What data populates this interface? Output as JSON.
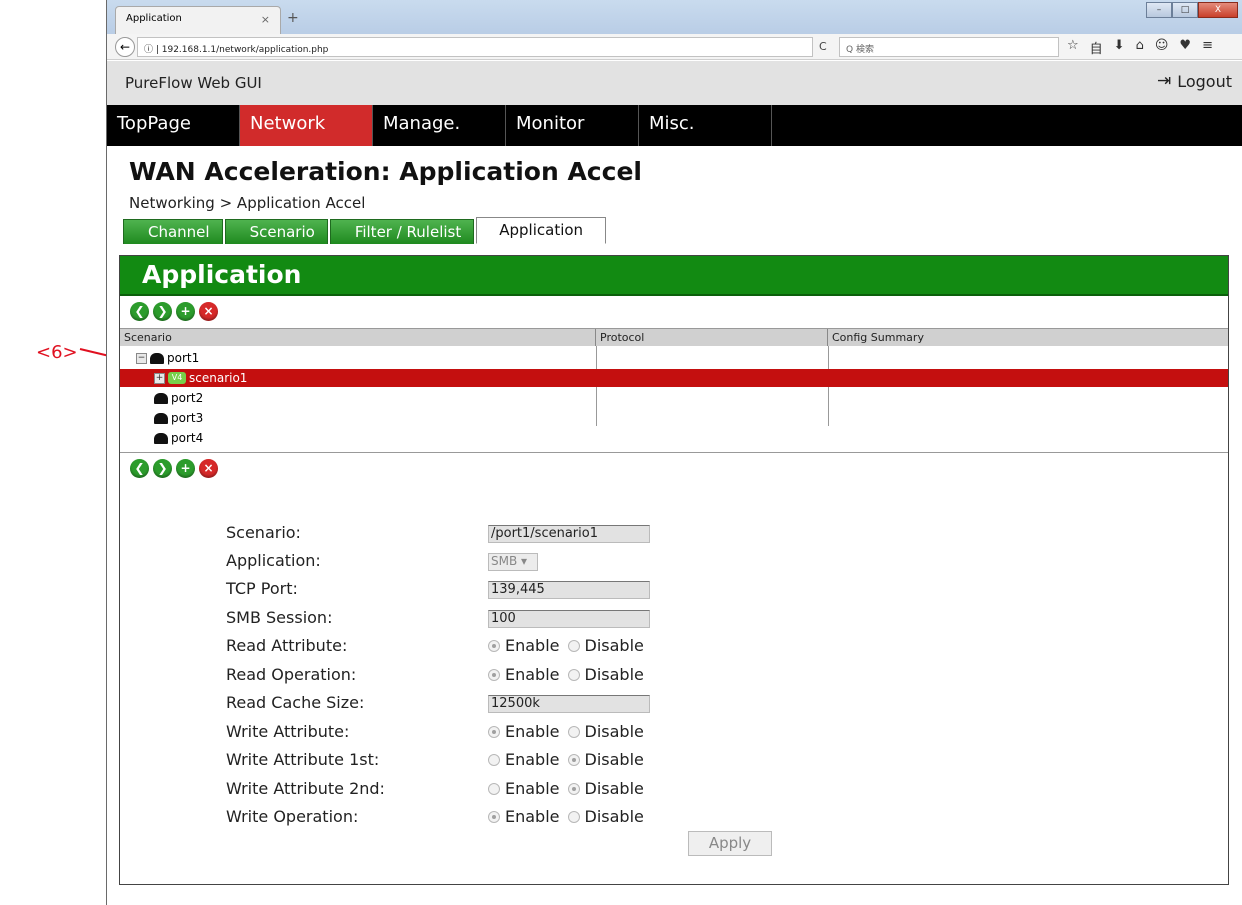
{
  "annotation": {
    "label": "<6>",
    "color": "#e01020"
  },
  "browser": {
    "tab_title": "Application",
    "tab_close": "×",
    "new_tab": "+",
    "back": "←",
    "url": "ⓘ | 192.168.1.1/network/application.php",
    "reload": "C",
    "search_placeholder": "Q 検索",
    "toolbar_icons": [
      "☆",
      "自",
      "⬇",
      "⌂",
      "☺",
      "♥",
      "≡"
    ],
    "window_controls": {
      "minimize": "–",
      "maximize": "□",
      "close": "X"
    }
  },
  "app": {
    "title": "PureFlow Web GUI",
    "logout_label": "Logout",
    "menu": [
      {
        "label": "TopPage",
        "active": false
      },
      {
        "label": "Network",
        "active": true
      },
      {
        "label": "Manage.",
        "active": false
      },
      {
        "label": "Monitor",
        "active": false
      },
      {
        "label": "Misc.",
        "active": false
      }
    ],
    "menu_active_color": "#d12b2b",
    "page_heading": "WAN Acceleration: Application Accel",
    "breadcrumb": "Networking > Application Accel",
    "tabs": [
      "Channel",
      "Scenario",
      "Filter / Rulelist",
      "Application"
    ],
    "active_tab": "Application"
  },
  "panel": {
    "title": "Application",
    "header_color": "#128a12",
    "buttons": [
      "back",
      "forward",
      "add",
      "delete"
    ],
    "columns": [
      "Scenario",
      "Protocol",
      "Config Summary"
    ],
    "tree": [
      {
        "label": "port1",
        "expander": "−",
        "icon": "port-icon"
      },
      {
        "label": "scenario1",
        "expander": "+",
        "icon": "scenario-icon",
        "icon_text": "V4",
        "selected": true
      },
      {
        "label": "port2",
        "icon": "port-icon"
      },
      {
        "label": "port3",
        "icon": "port-icon"
      },
      {
        "label": "port4",
        "icon": "port-icon"
      }
    ],
    "selected_color": "#c40f0f"
  },
  "form": {
    "scenario_label": "Scenario:",
    "scenario_value": "/port1/scenario1",
    "application_label": "Application:",
    "application_value": "SMB",
    "tcp_port_label": "TCP Port:",
    "tcp_port_value": "139,445",
    "smb_session_label": "SMB Session:",
    "smb_session_value": "100",
    "read_attribute_label": "Read Attribute:",
    "read_operation_label": "Read Operation:",
    "read_cache_size_label": "Read Cache Size:",
    "read_cache_size_value": "12500k",
    "write_attribute_label": "Write Attribute:",
    "write_attribute_1st_label": "Write Attribute 1st:",
    "write_attribute_2nd_label": "Write Attribute 2nd:",
    "write_operation_label": "Write Operation:",
    "enable_label": "Enable",
    "disable_label": "Disable",
    "radios": {
      "read_attribute": "Enable",
      "read_operation": "Enable",
      "write_attribute": "Enable",
      "write_attribute_1st": "Disable",
      "write_attribute_2nd": "Disable",
      "write_operation": "Enable"
    },
    "apply_label": "Apply"
  }
}
